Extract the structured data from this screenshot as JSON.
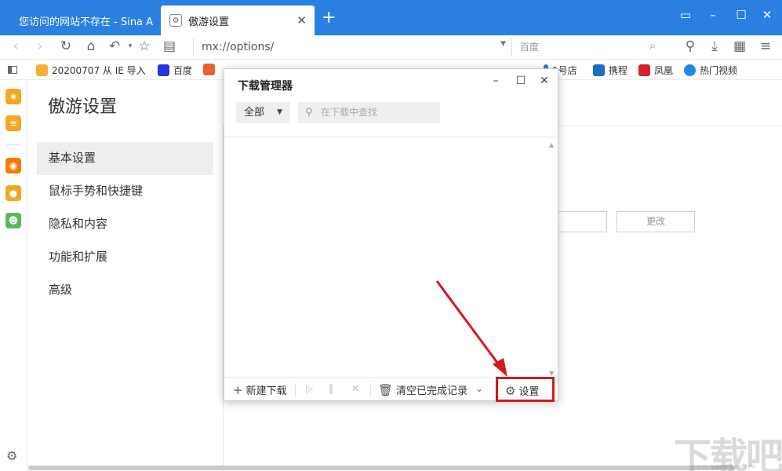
{
  "tabs": [
    {
      "title": "您访问的网站不存在 - Sina A"
    },
    {
      "title": "傲游设置",
      "favicon": "gear-icon"
    }
  ],
  "window": {
    "controls": [
      "restore-icon",
      "minimize-icon",
      "maximize-icon",
      "close-icon"
    ]
  },
  "address": {
    "url": "mx://options/"
  },
  "search": {
    "placeholder": "百度"
  },
  "bookmarks": [
    {
      "label": "20200707 从 IE 导入",
      "icon": "folder-icon",
      "color": "#f2b233"
    },
    {
      "label": "百度",
      "icon": "baidu-icon",
      "color": "#2932e1"
    },
    {
      "label": "1号店",
      "icon": "yhd-icon",
      "color": "#1e88e5"
    },
    {
      "label": "携程",
      "icon": "ctrip-icon",
      "color": "#1b6ec2"
    },
    {
      "label": "凤凰",
      "icon": "ifeng-icon",
      "color": "#d2232a"
    },
    {
      "label": "热门视频",
      "icon": "ie-icon",
      "color": "#1e88e5"
    }
  ],
  "page": {
    "title": "傲游设置",
    "nav": [
      {
        "label": "基本设置",
        "active": true
      },
      {
        "label": "鼠标手势和快捷键"
      },
      {
        "label": "隐私和内容"
      },
      {
        "label": "功能和扩展"
      },
      {
        "label": "高级"
      }
    ],
    "change_button": "更改"
  },
  "download_manager": {
    "title": "下载管理器",
    "filter": "全部",
    "search_placeholder": "在下载中查找",
    "new_download": "新建下载",
    "clear_completed": "清空已完成记录",
    "settings": "设置"
  },
  "colors": {
    "accent": "#2b7fe0",
    "highlight": "#d9161c"
  }
}
